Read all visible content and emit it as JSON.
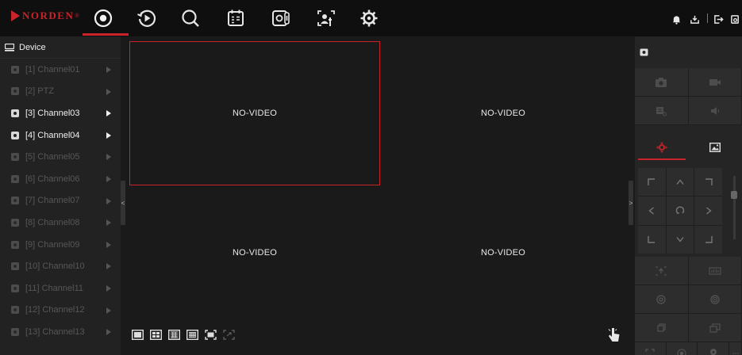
{
  "brand": {
    "name": "NORDEN",
    "mark": "®"
  },
  "topnav": {
    "items": [
      {
        "icon": "live-view-icon",
        "active": true
      },
      {
        "icon": "playback-icon",
        "active": false
      },
      {
        "icon": "search-icon",
        "active": false
      },
      {
        "icon": "schedule-icon",
        "active": false
      },
      {
        "icon": "ai-analysis-icon",
        "active": false
      },
      {
        "icon": "face-recognition-icon",
        "active": false
      },
      {
        "icon": "settings-gear-icon",
        "active": false
      }
    ],
    "right_icons": [
      "alarm-bell-icon",
      "download-icon",
      "logout-icon",
      "lock-icon"
    ]
  },
  "sidebar": {
    "title": "Device",
    "channels": [
      {
        "label": "[1] Channel01",
        "active": false
      },
      {
        "label": "[2] PTZ",
        "active": false
      },
      {
        "label": "[3] Channel03",
        "active": true
      },
      {
        "label": "[4] Channel04",
        "active": true
      },
      {
        "label": "[5] Channel05",
        "active": false
      },
      {
        "label": "[6] Channel06",
        "active": false
      },
      {
        "label": "[7] Channel07",
        "active": false
      },
      {
        "label": "[8] Channel08",
        "active": false
      },
      {
        "label": "[9] Channel09",
        "active": false
      },
      {
        "label": "[10] Channel10",
        "active": false
      },
      {
        "label": "[11] Channel11",
        "active": false
      },
      {
        "label": "[12] Channel12",
        "active": false
      },
      {
        "label": "[13] Channel13",
        "active": false
      }
    ],
    "collapse_glyph": "<"
  },
  "video": {
    "cells": [
      {
        "text": "NO-VIDEO",
        "selected": true
      },
      {
        "text": "NO-VIDEO",
        "selected": false
      },
      {
        "text": "NO-VIDEO",
        "selected": false
      },
      {
        "text": "NO-VIDEO",
        "selected": false
      }
    ],
    "layouts": [
      "layout-1-icon",
      "layout-4-icon",
      "layout-9-icon",
      "layout-16-icon",
      "fullscreen-icon",
      "original-scale-icon"
    ]
  },
  "right_panel": {
    "collapse_glyph": ">",
    "ptz_directions": [
      "up-left",
      "up",
      "up-right",
      "left",
      "auto-scan",
      "right",
      "down-left",
      "down",
      "down-right"
    ]
  },
  "colors": {
    "accent": "#c9242a",
    "background": "#1a1a1a",
    "topbar": "#0f0f0f"
  }
}
